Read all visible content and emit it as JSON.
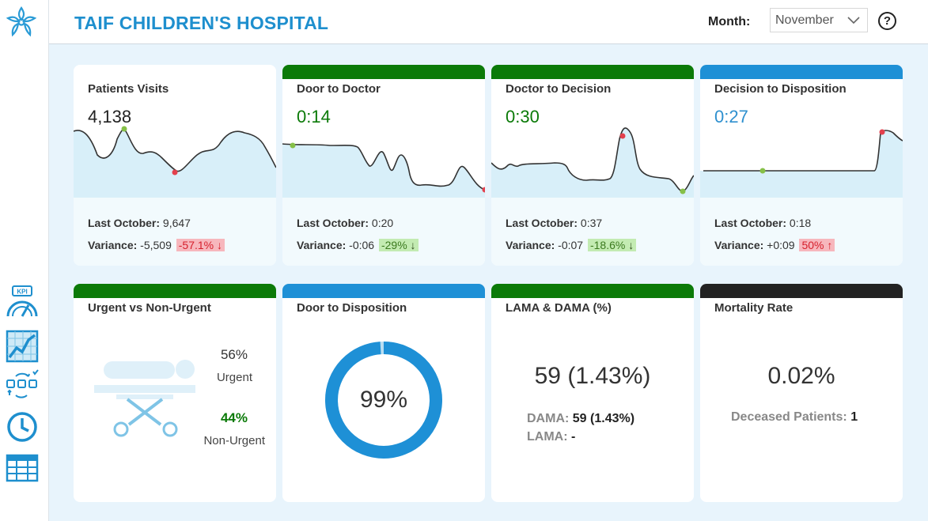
{
  "header": {
    "title": "TAIF CHILDREN'S HOSPITAL",
    "month_label": "Month:",
    "month_value": "November",
    "help": "?"
  },
  "colors": {
    "brand_blue": "#1e8fce",
    "green": "#0b7a08",
    "blue_bar": "#1e90d6",
    "black_bar": "#222222",
    "red": "#d61f2c"
  },
  "sidebar": {
    "items": [
      {
        "name": "logo",
        "icon": "flower-logo-icon"
      },
      {
        "name": "kpi",
        "icon": "kpi-gauge-icon"
      },
      {
        "name": "trend",
        "icon": "line-chart-icon"
      },
      {
        "name": "flow",
        "icon": "process-flow-icon"
      },
      {
        "name": "time",
        "icon": "clock-icon"
      },
      {
        "name": "table",
        "icon": "table-icon"
      }
    ]
  },
  "kpis": [
    {
      "title": "Patients Visits",
      "value": "4,138",
      "last_label": "Last October:",
      "last_value": "9,647",
      "variance_label": "Variance:",
      "variance_value": "-5,509",
      "variance_pct": "-57.1%",
      "arrow": "↓"
    },
    {
      "title": "Door to Doctor",
      "value": "0:14",
      "last_label": "Last October:",
      "last_value": "0:20",
      "variance_label": "Variance:",
      "variance_value": "-0:06",
      "variance_pct": "-29%",
      "arrow": "↓"
    },
    {
      "title": "Doctor to Decision",
      "value": "0:30",
      "last_label": "Last October:",
      "last_value": "0:37",
      "variance_label": "Variance:",
      "variance_value": "-0:07",
      "variance_pct": "-18.6%",
      "arrow": "↓"
    },
    {
      "title": "Decision to Disposition",
      "value": "0:27",
      "last_label": "Last October:",
      "last_value": "0:18",
      "variance_label": "Variance:",
      "variance_value": "+0:09",
      "variance_pct": "50%",
      "arrow": "↑"
    }
  ],
  "urgent": {
    "title": "Urgent vs Non-Urgent",
    "urgent_pct": "56%",
    "urgent_label": "Urgent",
    "non_urgent_pct": "44%",
    "non_urgent_label": "Non-Urgent",
    "urgent_share": 0.56
  },
  "door_to_disposition": {
    "title": "Door to Disposition",
    "value": "99%",
    "share": 0.99
  },
  "lama_dama": {
    "title": "LAMA & DAMA (%)",
    "value": "59 (1.43%)",
    "dama_label": "DAMA:",
    "dama_value": "59 (1.43%)",
    "lama_label": "LAMA:",
    "lama_value": "-"
  },
  "mortality": {
    "title": "Mortality Rate",
    "value": "0.02%",
    "deceased_label": "Deceased Patients:",
    "deceased_value": "1"
  }
}
